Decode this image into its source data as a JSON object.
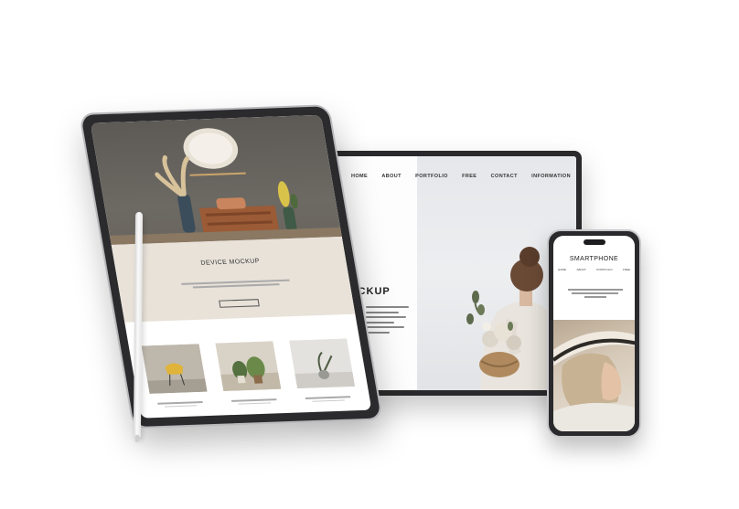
{
  "desktop": {
    "nav": [
      "HOME",
      "ABOUT",
      "PORTFOLIO",
      "FREE",
      "CONTACT",
      "INFORMATION"
    ],
    "hero_text": "OCKUP"
  },
  "tablet": {
    "title": "DEVICE MOCKUP",
    "button": "",
    "section_title": "",
    "cards": 3
  },
  "phone": {
    "title": "SMARTPHONE"
  },
  "colors": {
    "device_frame": "#2a2a2c",
    "background": "#ffffff"
  }
}
